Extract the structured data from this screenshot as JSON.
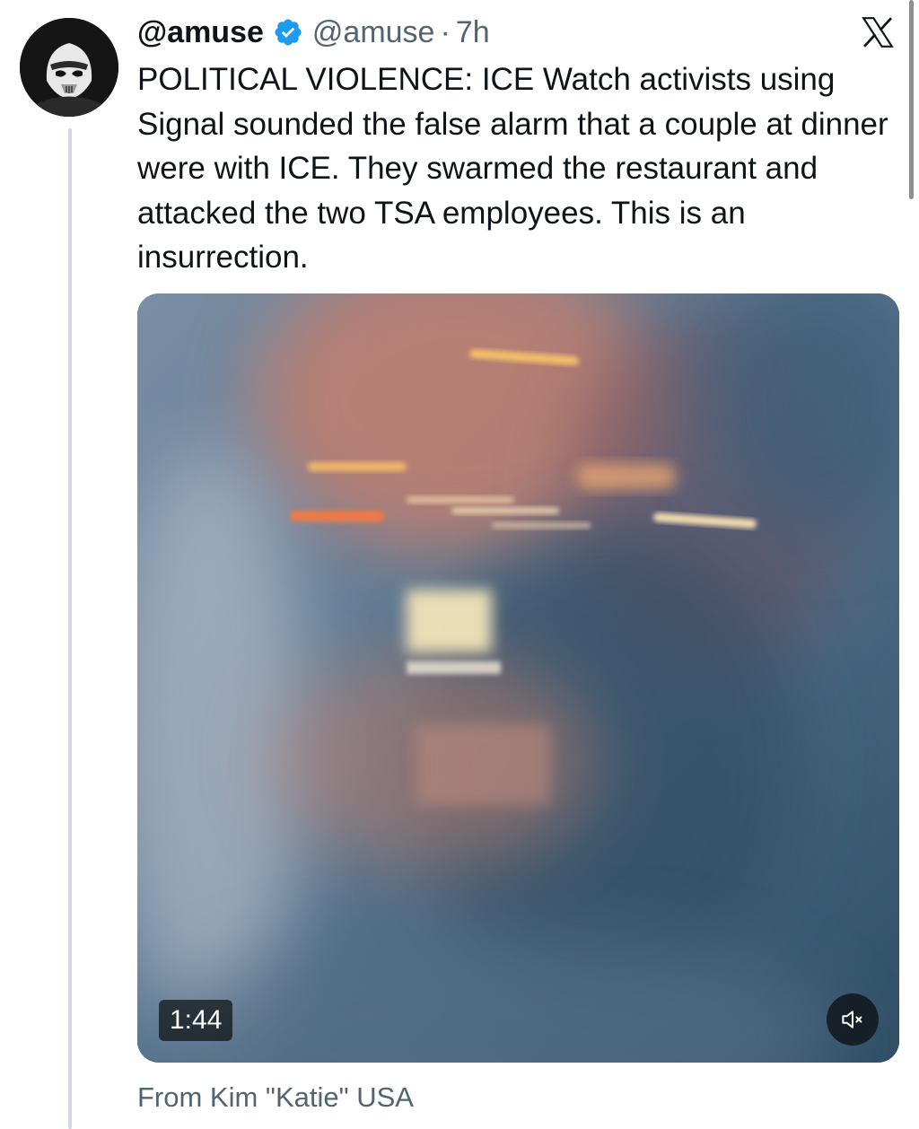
{
  "post": {
    "display_name": "@amuse",
    "handle": "@amuse",
    "separator": "·",
    "time": "7h",
    "text": "POLITICAL VIOLENCE: ICE Watch activists using Signal sounded the false alarm that a couple at dinner were with ICE. They swarmed the restaurant and attacked the two TSA employees. This is an insurrection.",
    "verified_icon": "verified-badge-icon",
    "platform_icon": "x-logo-icon"
  },
  "media": {
    "duration": "1:44",
    "mute_icon": "speaker-muted-icon"
  },
  "source_line": "From Kim \"Katie\" USA",
  "colors": {
    "verified_badge": "#1d9bf0",
    "secondary_text": "#536471",
    "primary_text": "#0f1419",
    "thread_line": "#cfd9de"
  }
}
